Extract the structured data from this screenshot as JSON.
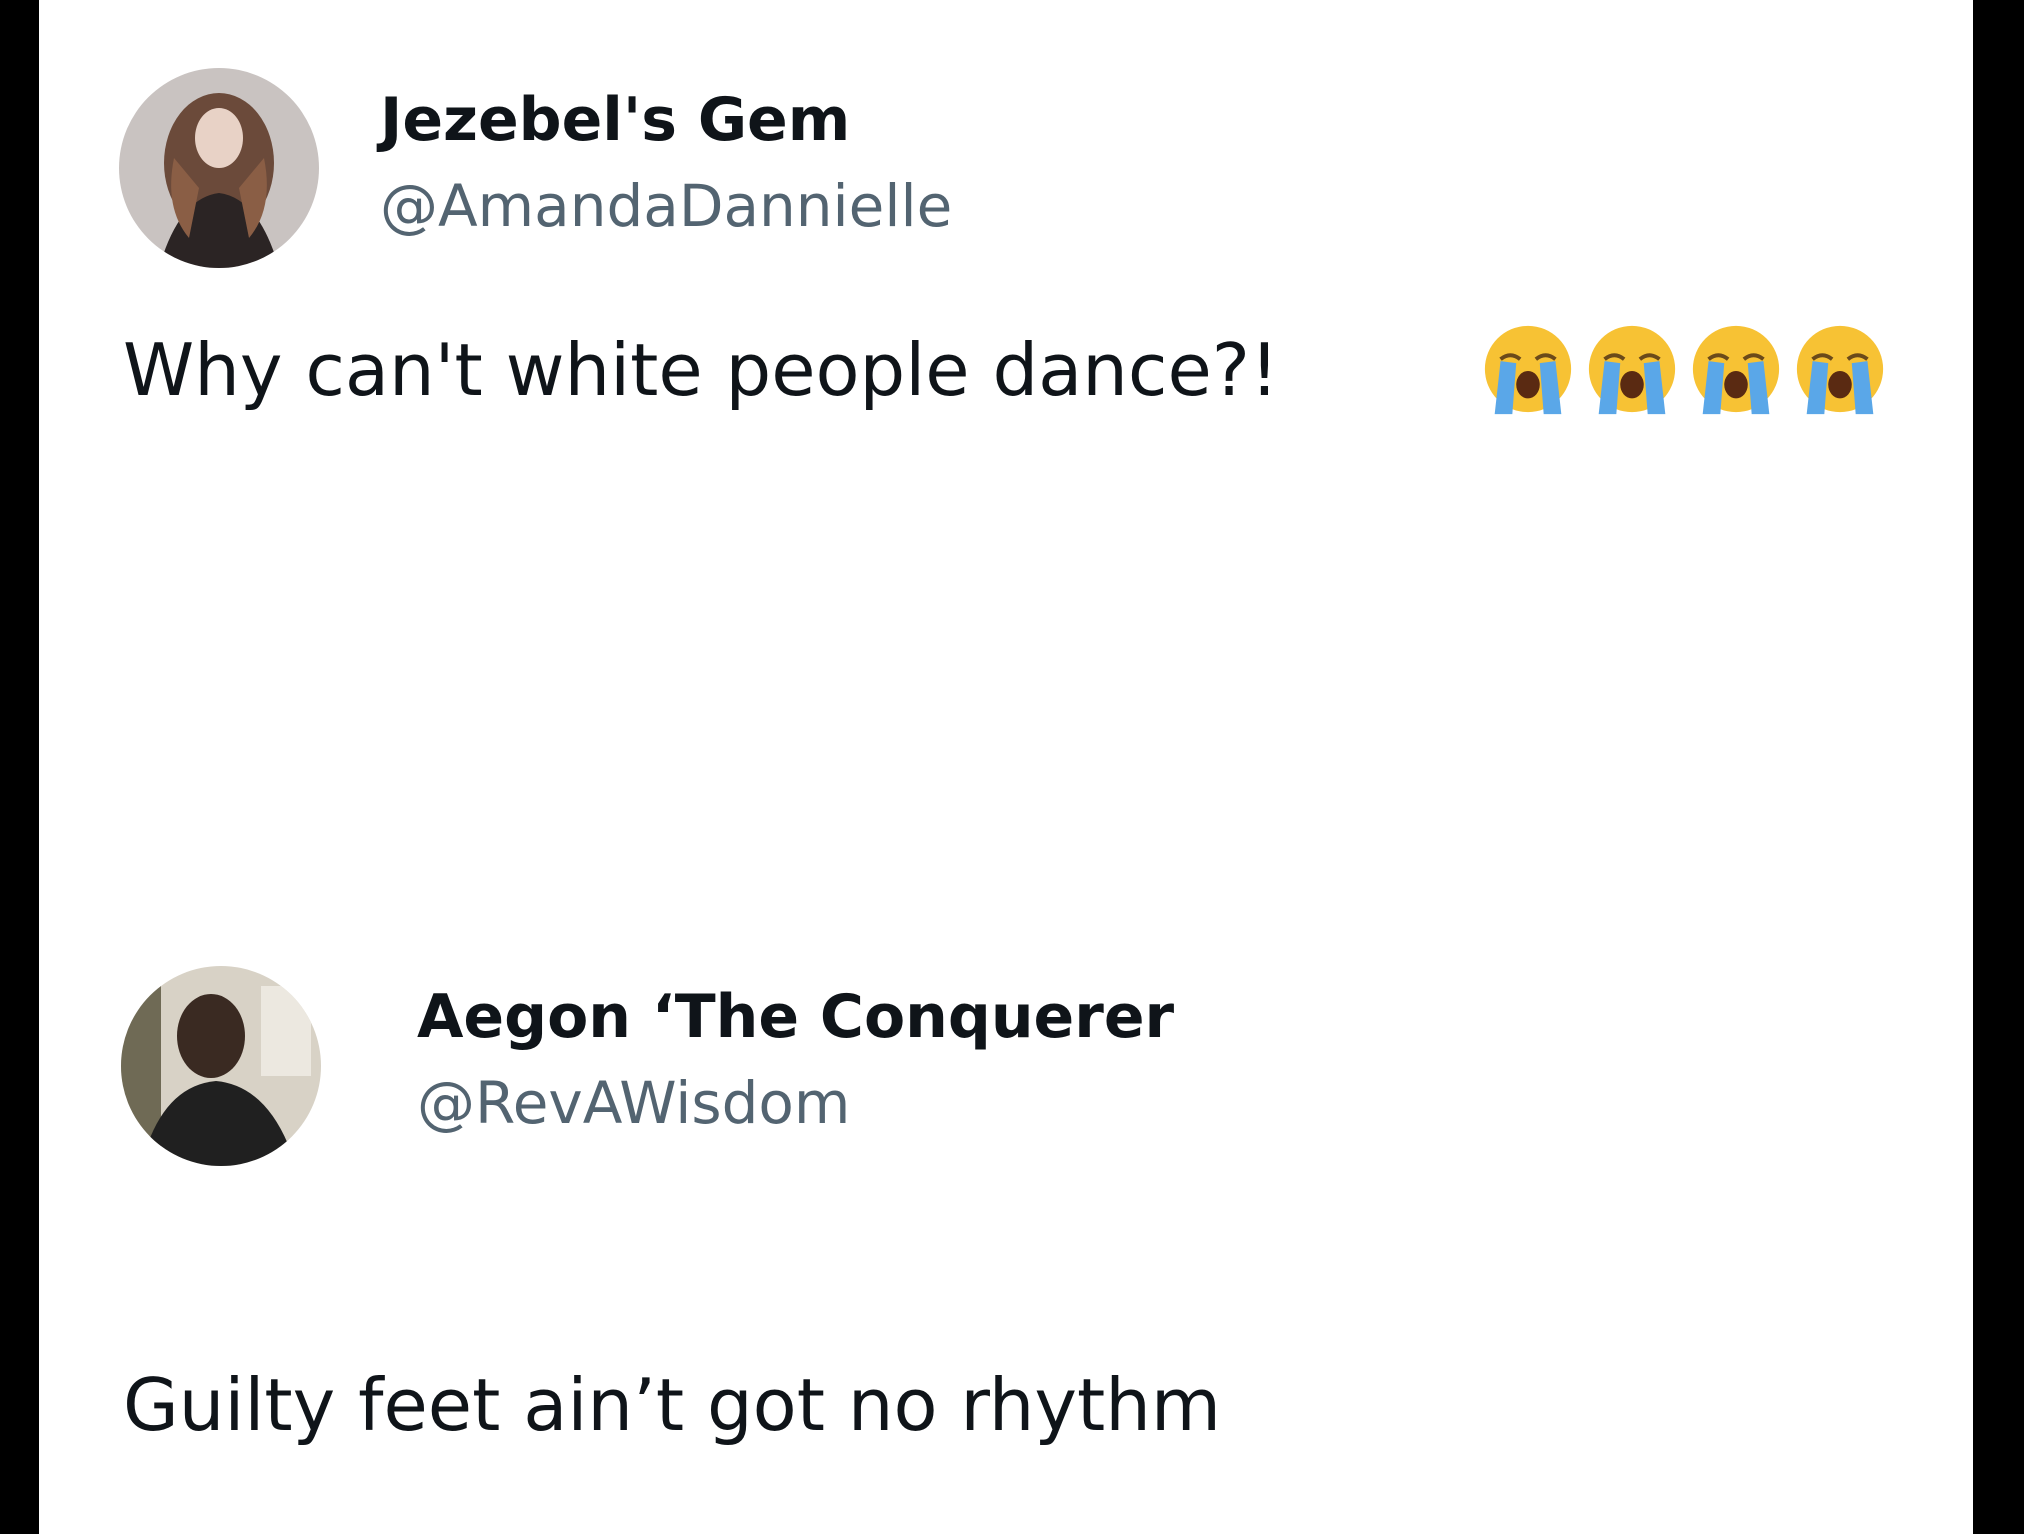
{
  "tweets": [
    {
      "display_name": "Jezebel's Gem",
      "handle": "@AmandaDannielle",
      "text": "Why can't white people dance?!",
      "emoji": [
        "loudly-crying-face",
        "loudly-crying-face",
        "loudly-crying-face",
        "loudly-crying-face"
      ]
    },
    {
      "display_name": "Aegon ‘The Conquerer",
      "handle": "@RevAWisdom",
      "text": "Guilty feet ain’t got no rhythm"
    }
  ],
  "colors": {
    "background": "#ffffff",
    "frame": "#000000",
    "name": "#0f1419",
    "handle": "#536471",
    "emoji_face": "#f7c234",
    "emoji_tears": "#5aa7e8"
  }
}
